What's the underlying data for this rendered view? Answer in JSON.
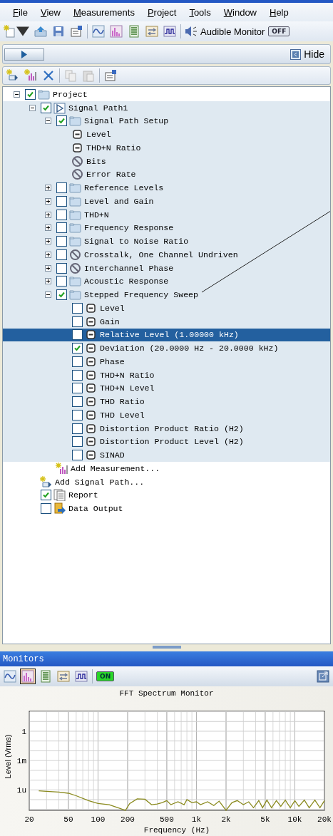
{
  "menu": [
    "File",
    "View",
    "Measurements",
    "Project",
    "Tools",
    "Window",
    "Help"
  ],
  "audible_monitor": {
    "label": "Audible Monitor",
    "toggle": "OFF",
    "on": false
  },
  "panel": {
    "hide_label": "Hide"
  },
  "tree": [
    {
      "label": "Project",
      "kind": "folder",
      "expanded": true,
      "checked": true,
      "selected": false,
      "children": [
        {
          "label": "Signal Path1",
          "kind": "signal-path",
          "expanded": true,
          "checked": true,
          "selected": false,
          "active": true,
          "children": [
            {
              "label": "Signal Path Setup",
              "kind": "folder",
              "expanded": true,
              "checked": true,
              "selected": false,
              "children": [
                {
                  "label": "Level",
                  "kind": "measurement",
                  "selected": false
                },
                {
                  "label": "THD+N Ratio",
                  "kind": "measurement",
                  "selected": false
                },
                {
                  "label": "Bits",
                  "kind": "unavailable",
                  "selected": false
                },
                {
                  "label": "Error Rate",
                  "kind": "unavailable",
                  "selected": false
                }
              ]
            },
            {
              "label": "Reference Levels",
              "kind": "folder",
              "expanded": false,
              "checked": false,
              "selected": false
            },
            {
              "label": "Level and Gain",
              "kind": "folder",
              "expanded": false,
              "checked": false,
              "selected": false
            },
            {
              "label": "THD+N",
              "kind": "folder",
              "expanded": false,
              "checked": false,
              "selected": false
            },
            {
              "label": "Frequency Response",
              "kind": "folder",
              "expanded": false,
              "checked": false,
              "selected": false
            },
            {
              "label": "Signal to Noise Ratio",
              "kind": "folder",
              "expanded": false,
              "checked": false,
              "selected": false
            },
            {
              "label": "Crosstalk, One Channel Undriven",
              "kind": "unavailable",
              "expanded": false,
              "checked": false,
              "selected": false
            },
            {
              "label": "Interchannel Phase",
              "kind": "unavailable",
              "expanded": false,
              "checked": false,
              "selected": false
            },
            {
              "label": "Acoustic Response",
              "kind": "folder",
              "expanded": false,
              "checked": false,
              "selected": false
            },
            {
              "label": "Stepped Frequency Sweep",
              "kind": "folder",
              "expanded": true,
              "checked": true,
              "selected": false,
              "children": [
                {
                  "label": "Level",
                  "kind": "measurement",
                  "checked": false,
                  "selected": false
                },
                {
                  "label": "Gain",
                  "kind": "measurement",
                  "checked": false,
                  "selected": false
                },
                {
                  "label": "Relative Level (1.00000 kHz)",
                  "kind": "measurement",
                  "checked": false,
                  "selected": true
                },
                {
                  "label": "Deviation (20.0000 Hz - 20.0000 kHz)",
                  "kind": "measurement",
                  "checked": true,
                  "selected": false
                },
                {
                  "label": "Phase",
                  "kind": "measurement",
                  "checked": false,
                  "selected": false
                },
                {
                  "label": "THD+N Ratio",
                  "kind": "measurement",
                  "checked": false,
                  "selected": false
                },
                {
                  "label": "THD+N Level",
                  "kind": "measurement",
                  "checked": false,
                  "selected": false
                },
                {
                  "label": "THD Ratio",
                  "kind": "measurement",
                  "checked": false,
                  "selected": false
                },
                {
                  "label": "THD Level",
                  "kind": "measurement",
                  "checked": false,
                  "selected": false
                },
                {
                  "label": "Distortion Product Ratio (H2)",
                  "kind": "measurement",
                  "checked": false,
                  "selected": false
                },
                {
                  "label": "Distortion Product Level (H2)",
                  "kind": "measurement",
                  "checked": false,
                  "selected": false
                },
                {
                  "label": "SINAD",
                  "kind": "measurement",
                  "checked": false,
                  "selected": false
                }
              ]
            },
            {
              "label": "Add Measurement...",
              "kind": "add-measurement",
              "selected": false
            }
          ]
        },
        {
          "label": "Add Signal Path...",
          "kind": "add-signal-path",
          "selected": false
        },
        {
          "label": "Report",
          "kind": "report",
          "checked": true,
          "selected": false
        },
        {
          "label": "Data Output",
          "kind": "data-output",
          "checked": false,
          "selected": false
        }
      ]
    }
  ],
  "monitors": {
    "title": "Monitors",
    "buttons": [
      {
        "selected": false
      },
      {
        "selected": true
      },
      {
        "selected": false
      },
      {
        "selected": false
      },
      {
        "selected": false
      }
    ],
    "toggle": "ON",
    "on": true,
    "chart": {
      "title": "FFT Spectrum Monitor",
      "xlabel": "Frequency (Hz)",
      "ylabel": "Level (Vrms)",
      "x_tick_labels": [
        "20",
        "50",
        "100",
        "200",
        "500",
        "1k",
        "2k",
        "5k",
        "10k",
        "20k"
      ],
      "y_tick_labels": [
        "1",
        "1m",
        "1u"
      ]
    }
  }
}
